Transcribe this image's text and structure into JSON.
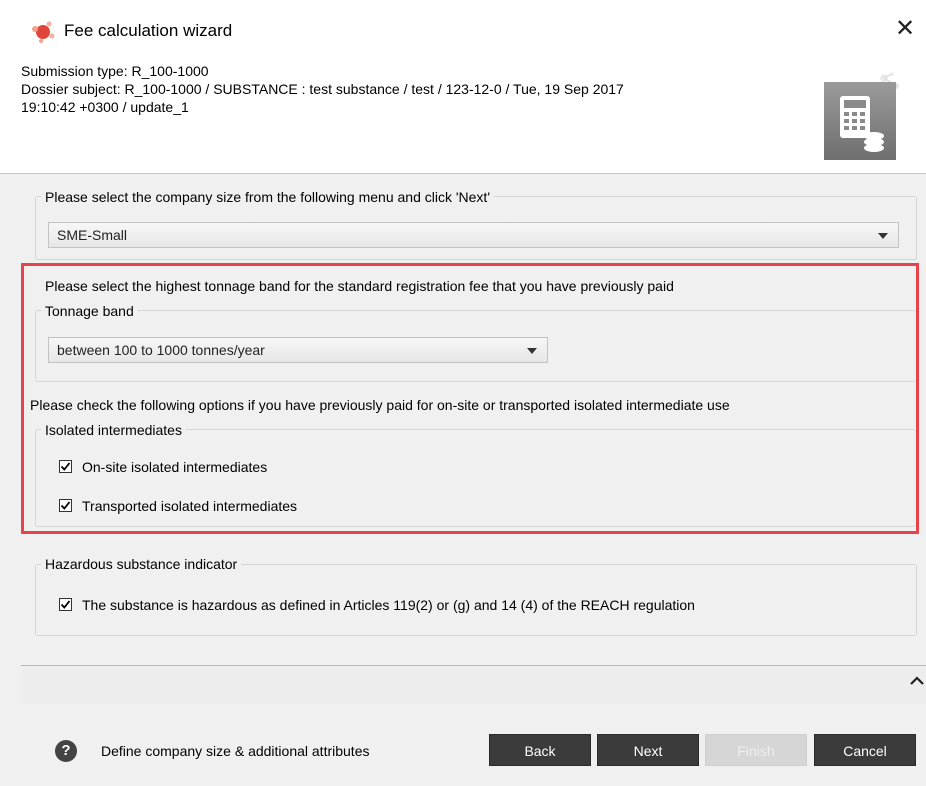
{
  "window": {
    "title": "Fee calculation wizard",
    "close_glyph": "✕"
  },
  "header": {
    "submission_type": "Submission type: R_100-1000",
    "dossier_subject_line1": "Dossier subject: R_100-1000 / SUBSTANCE : test substance / test / 123-12-0 / Tue, 19 Sep 2017",
    "dossier_subject_line2": "19:10:42 +0300 / update_1"
  },
  "company_size": {
    "prompt": "Please select the company size from the following menu and click 'Next'",
    "selected": "SME-Small"
  },
  "tonnage": {
    "prompt": "Please select the highest tonnage band for the standard registration fee that you have previously paid",
    "group_label": "Tonnage band",
    "selected": "between 100 to 1000 tonnes/year"
  },
  "intermediates": {
    "prompt": "Please check the following options if you have previously paid for on-site or transported isolated intermediate use",
    "group_label": "Isolated intermediates",
    "options": [
      {
        "label": "On-site isolated intermediates",
        "checked": true
      },
      {
        "label": "Transported isolated intermediates",
        "checked": true
      }
    ]
  },
  "hazard": {
    "group_label": "Hazardous substance indicator",
    "option_label": "The substance is hazardous as defined in Articles 119(2) or (g) and 14 (4) of the REACH regulation",
    "checked": true
  },
  "footer": {
    "help_glyph": "?",
    "description": "Define company size & additional attributes",
    "buttons": {
      "back": "Back",
      "next": "Next",
      "finish": "Finish",
      "cancel": "Cancel"
    }
  },
  "colors": {
    "highlight": "#e8434a",
    "button_dark": "#3b3b3b",
    "button_disabled": "#d6d6d6"
  }
}
